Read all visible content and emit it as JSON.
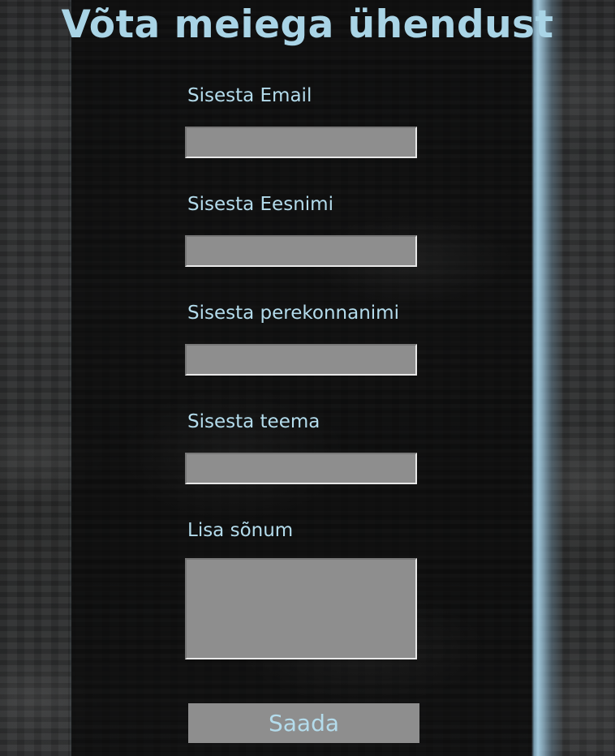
{
  "page": {
    "title": "Võta meiega ühendust"
  },
  "form": {
    "fields": [
      {
        "label": "Sisesta Email",
        "value": "",
        "placeholder": ""
      },
      {
        "label": "Sisesta Eesnimi",
        "value": "",
        "placeholder": ""
      },
      {
        "label": "Sisesta perekonnanimi",
        "value": "",
        "placeholder": ""
      },
      {
        "label": "Sisesta teema",
        "value": "",
        "placeholder": ""
      },
      {
        "label": "Lisa sõnum",
        "value": "",
        "placeholder": ""
      }
    ],
    "submit_label": "Saada"
  },
  "colors": {
    "accent_text": "#b4dcec",
    "title_text": "#a9d4e6",
    "input_background": "#8e8e8e",
    "panel_background": "#080808"
  }
}
